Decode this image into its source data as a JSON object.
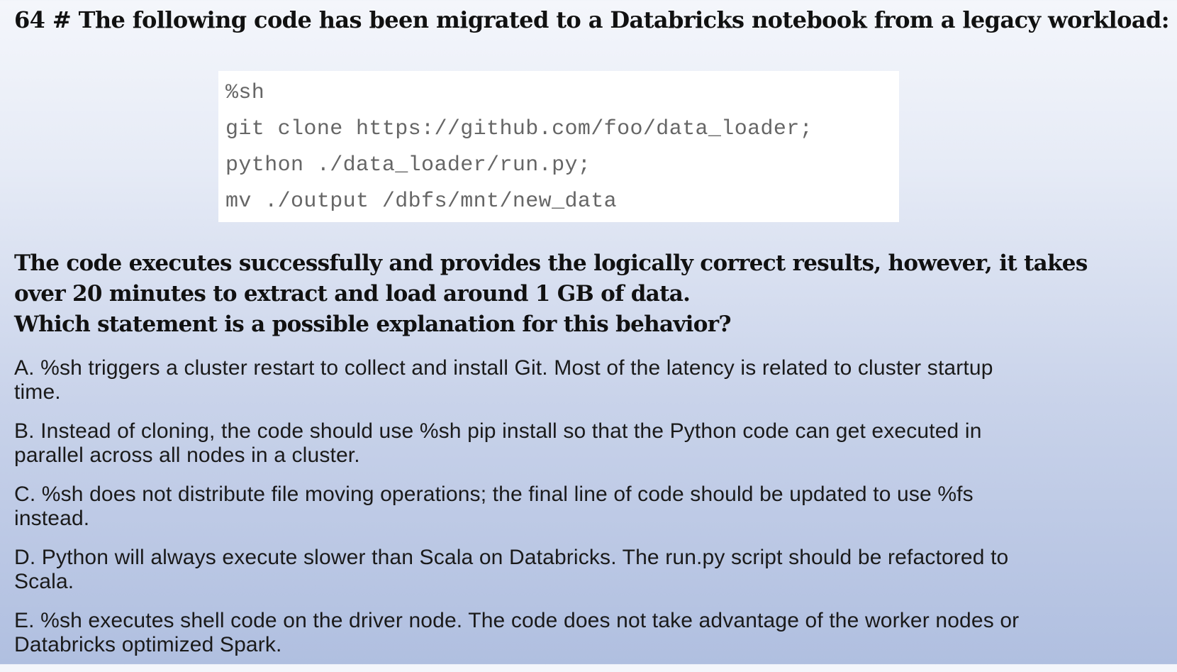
{
  "question": {
    "header": "64 # The following code has been migrated to a Databricks notebook from a legacy workload:",
    "code_lines": [
      "%sh",
      "git clone https://github.com/foo/data_loader;",
      "python ./data_loader/run.py;",
      "mv ./output /dbfs/mnt/new_data"
    ],
    "prompt_lines": [
      "The code executes successfully and provides the logically correct results, however, it takes",
      "over 20 minutes to extract and load around 1 GB of data.",
      "Which statement is a possible explanation for this behavior?"
    ]
  },
  "options": [
    {
      "lines": [
        "A. %sh triggers a cluster restart to collect and install Git. Most of the latency is related to cluster startup",
        "time."
      ]
    },
    {
      "lines": [
        "B. Instead of cloning, the code should use %sh pip install so that the Python code can get executed in",
        "parallel across all nodes in a cluster."
      ]
    },
    {
      "lines": [
        "C. %sh does not distribute file moving operations; the final line of code should be updated to use %fs",
        "instead."
      ]
    },
    {
      "lines": [
        "D. Python will always execute slower than Scala on Databricks. The run.py script should be refactored to",
        "Scala."
      ]
    },
    {
      "lines": [
        "E. %sh executes shell code on the driver node. The code does not take advantage of the worker nodes or",
        "Databricks optimized Spark."
      ]
    }
  ]
}
